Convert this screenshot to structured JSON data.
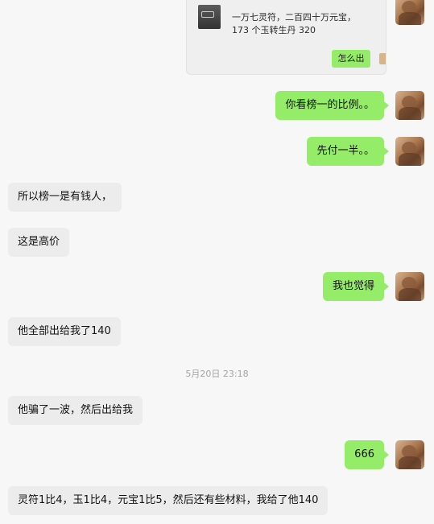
{
  "card": {
    "text": "一万七灵符，二百四十万元宝，\n173 个玉转生丹 320",
    "button": "怎么出"
  },
  "messages": [
    {
      "side": "right",
      "text": "你看榜一的比例。。"
    },
    {
      "side": "right",
      "text": "先付一半。。"
    },
    {
      "side": "left",
      "text": "所以榜一是有钱人，"
    },
    {
      "side": "left",
      "text": "这是高价"
    },
    {
      "side": "right",
      "text": "我也觉得"
    },
    {
      "side": "left",
      "text": "他全部出给我了140"
    },
    {
      "side": "left",
      "text": "他骗了一波，然后出给我"
    },
    {
      "side": "right",
      "text": "666"
    },
    {
      "side": "left",
      "text": "灵符1比4，玉1比4，元宝1比5，然后还有些材料，我给了他140"
    }
  ],
  "timestamp": "5月20日 23:18",
  "colors": {
    "bubble_green": "#95ec69",
    "bubble_gray": "#ececec",
    "background": "#f7f7f7",
    "timestamp": "#a3a3a3"
  },
  "icons": {
    "avatar": "user-avatar-photo"
  }
}
